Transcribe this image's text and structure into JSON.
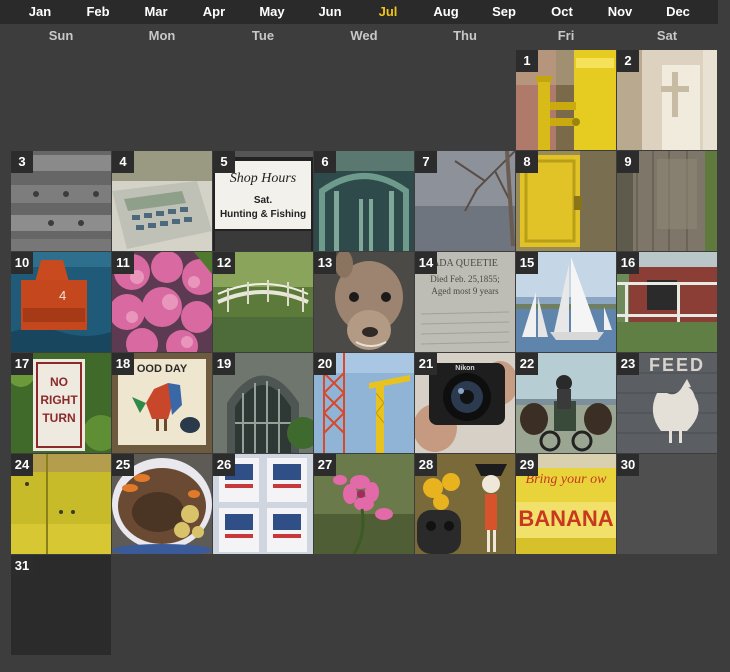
{
  "months": [
    "Jan",
    "Feb",
    "Mar",
    "Apr",
    "May",
    "Jun",
    "Jul",
    "Aug",
    "Sep",
    "Oct",
    "Nov",
    "Dec"
  ],
  "active_month": "Jul",
  "weekdays": [
    "Sun",
    "Mon",
    "Tue",
    "Wed",
    "Thu",
    "Fri",
    "Sat"
  ],
  "days": [
    {
      "n": "1",
      "icon": "yellow-mailbox",
      "kind": "yellow-post"
    },
    {
      "n": "2",
      "icon": "church-wall",
      "kind": "pale-wall"
    },
    {
      "n": "3",
      "icon": "metal-rails",
      "kind": "rails"
    },
    {
      "n": "4",
      "icon": "calculator",
      "kind": "calculator"
    },
    {
      "n": "5",
      "icon": "shop-hours-sign",
      "kind": "sign",
      "caption": [
        "Shop Hours",
        "Sat.",
        "Hunting & Fishing"
      ]
    },
    {
      "n": "6",
      "icon": "green-porch-trim",
      "kind": "porch"
    },
    {
      "n": "7",
      "icon": "bare-branches",
      "kind": "branches"
    },
    {
      "n": "8",
      "icon": "yellow-door",
      "kind": "yellow-door"
    },
    {
      "n": "9",
      "icon": "weathered-post",
      "kind": "wood"
    },
    {
      "n": "10",
      "icon": "red-buoy",
      "kind": "buoy"
    },
    {
      "n": "11",
      "icon": "pink-hydrangea",
      "kind": "hydrangea"
    },
    {
      "n": "12",
      "icon": "garden-bridge",
      "kind": "bridge"
    },
    {
      "n": "13",
      "icon": "alpaca",
      "kind": "alpaca"
    },
    {
      "n": "14",
      "icon": "gravestone",
      "kind": "gravestone",
      "caption": [
        "ADA QUEETIE",
        "Died Feb. 25,1855;",
        "Aged most 9 years"
      ]
    },
    {
      "n": "15",
      "icon": "sailboats",
      "kind": "sailboats"
    },
    {
      "n": "16",
      "icon": "red-barn-window",
      "kind": "barn"
    },
    {
      "n": "17",
      "icon": "no-right-turn-sign",
      "kind": "no-right-turn",
      "caption": [
        "NO",
        "RIGHT",
        "TURN"
      ]
    },
    {
      "n": "18",
      "icon": "rooster-sign",
      "kind": "rooster",
      "caption": [
        "OOD DAY"
      ]
    },
    {
      "n": "19",
      "icon": "gothic-arch",
      "kind": "arch"
    },
    {
      "n": "20",
      "icon": "radio-tower-crane",
      "kind": "tower"
    },
    {
      "n": "21",
      "icon": "camera",
      "kind": "camera",
      "caption": [
        "Nikon"
      ]
    },
    {
      "n": "22",
      "icon": "horse-wagon",
      "kind": "wagon"
    },
    {
      "n": "23",
      "icon": "feed-wall-rooster",
      "kind": "feed",
      "caption": [
        "FEED"
      ]
    },
    {
      "n": "24",
      "icon": "yellow-panel",
      "kind": "yellow-panel"
    },
    {
      "n": "25",
      "icon": "pot-roast",
      "kind": "roast"
    },
    {
      "n": "26",
      "icon": "postage-stamps",
      "kind": "stamps"
    },
    {
      "n": "27",
      "icon": "pink-flower",
      "kind": "flower"
    },
    {
      "n": "28",
      "icon": "skeleton-figurine",
      "kind": "skeleton"
    },
    {
      "n": "29",
      "icon": "bananas-sign",
      "kind": "bananas",
      "caption": [
        "Bring your ow",
        "BANANA"
      ]
    },
    {
      "n": "30",
      "icon": "empty",
      "kind": "empty"
    },
    {
      "n": "31",
      "icon": "empty",
      "kind": "empty31"
    }
  ]
}
